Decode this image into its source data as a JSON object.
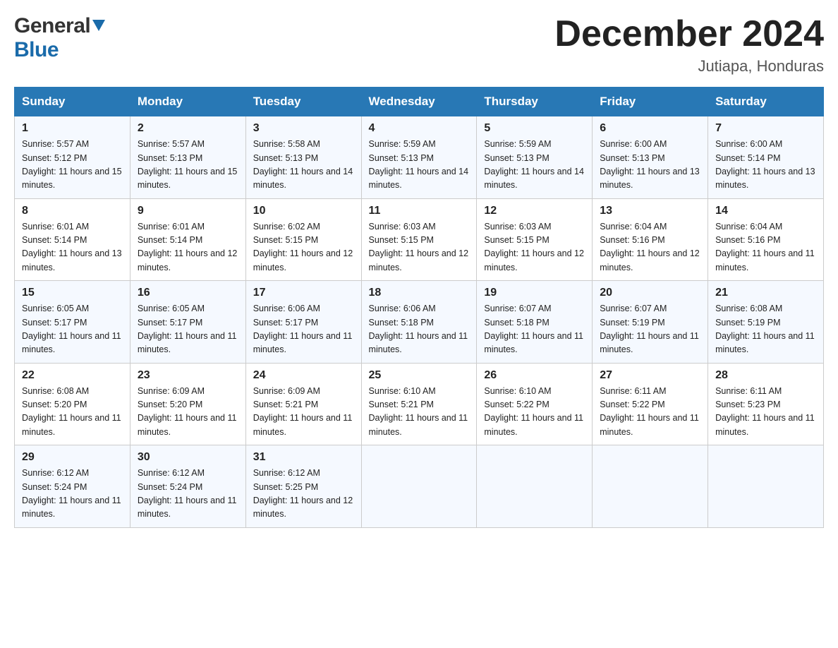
{
  "header": {
    "logo_general": "General",
    "logo_blue": "Blue",
    "month_title": "December 2024",
    "location": "Jutiapa, Honduras"
  },
  "days_of_week": [
    "Sunday",
    "Monday",
    "Tuesday",
    "Wednesday",
    "Thursday",
    "Friday",
    "Saturday"
  ],
  "weeks": [
    [
      {
        "day": "1",
        "sunrise": "5:57 AM",
        "sunset": "5:12 PM",
        "daylight": "11 hours and 15 minutes."
      },
      {
        "day": "2",
        "sunrise": "5:57 AM",
        "sunset": "5:13 PM",
        "daylight": "11 hours and 15 minutes."
      },
      {
        "day": "3",
        "sunrise": "5:58 AM",
        "sunset": "5:13 PM",
        "daylight": "11 hours and 14 minutes."
      },
      {
        "day": "4",
        "sunrise": "5:59 AM",
        "sunset": "5:13 PM",
        "daylight": "11 hours and 14 minutes."
      },
      {
        "day": "5",
        "sunrise": "5:59 AM",
        "sunset": "5:13 PM",
        "daylight": "11 hours and 14 minutes."
      },
      {
        "day": "6",
        "sunrise": "6:00 AM",
        "sunset": "5:13 PM",
        "daylight": "11 hours and 13 minutes."
      },
      {
        "day": "7",
        "sunrise": "6:00 AM",
        "sunset": "5:14 PM",
        "daylight": "11 hours and 13 minutes."
      }
    ],
    [
      {
        "day": "8",
        "sunrise": "6:01 AM",
        "sunset": "5:14 PM",
        "daylight": "11 hours and 13 minutes."
      },
      {
        "day": "9",
        "sunrise": "6:01 AM",
        "sunset": "5:14 PM",
        "daylight": "11 hours and 12 minutes."
      },
      {
        "day": "10",
        "sunrise": "6:02 AM",
        "sunset": "5:15 PM",
        "daylight": "11 hours and 12 minutes."
      },
      {
        "day": "11",
        "sunrise": "6:03 AM",
        "sunset": "5:15 PM",
        "daylight": "11 hours and 12 minutes."
      },
      {
        "day": "12",
        "sunrise": "6:03 AM",
        "sunset": "5:15 PM",
        "daylight": "11 hours and 12 minutes."
      },
      {
        "day": "13",
        "sunrise": "6:04 AM",
        "sunset": "5:16 PM",
        "daylight": "11 hours and 12 minutes."
      },
      {
        "day": "14",
        "sunrise": "6:04 AM",
        "sunset": "5:16 PM",
        "daylight": "11 hours and 11 minutes."
      }
    ],
    [
      {
        "day": "15",
        "sunrise": "6:05 AM",
        "sunset": "5:17 PM",
        "daylight": "11 hours and 11 minutes."
      },
      {
        "day": "16",
        "sunrise": "6:05 AM",
        "sunset": "5:17 PM",
        "daylight": "11 hours and 11 minutes."
      },
      {
        "day": "17",
        "sunrise": "6:06 AM",
        "sunset": "5:17 PM",
        "daylight": "11 hours and 11 minutes."
      },
      {
        "day": "18",
        "sunrise": "6:06 AM",
        "sunset": "5:18 PM",
        "daylight": "11 hours and 11 minutes."
      },
      {
        "day": "19",
        "sunrise": "6:07 AM",
        "sunset": "5:18 PM",
        "daylight": "11 hours and 11 minutes."
      },
      {
        "day": "20",
        "sunrise": "6:07 AM",
        "sunset": "5:19 PM",
        "daylight": "11 hours and 11 minutes."
      },
      {
        "day": "21",
        "sunrise": "6:08 AM",
        "sunset": "5:19 PM",
        "daylight": "11 hours and 11 minutes."
      }
    ],
    [
      {
        "day": "22",
        "sunrise": "6:08 AM",
        "sunset": "5:20 PM",
        "daylight": "11 hours and 11 minutes."
      },
      {
        "day": "23",
        "sunrise": "6:09 AM",
        "sunset": "5:20 PM",
        "daylight": "11 hours and 11 minutes."
      },
      {
        "day": "24",
        "sunrise": "6:09 AM",
        "sunset": "5:21 PM",
        "daylight": "11 hours and 11 minutes."
      },
      {
        "day": "25",
        "sunrise": "6:10 AM",
        "sunset": "5:21 PM",
        "daylight": "11 hours and 11 minutes."
      },
      {
        "day": "26",
        "sunrise": "6:10 AM",
        "sunset": "5:22 PM",
        "daylight": "11 hours and 11 minutes."
      },
      {
        "day": "27",
        "sunrise": "6:11 AM",
        "sunset": "5:22 PM",
        "daylight": "11 hours and 11 minutes."
      },
      {
        "day": "28",
        "sunrise": "6:11 AM",
        "sunset": "5:23 PM",
        "daylight": "11 hours and 11 minutes."
      }
    ],
    [
      {
        "day": "29",
        "sunrise": "6:12 AM",
        "sunset": "5:24 PM",
        "daylight": "11 hours and 11 minutes."
      },
      {
        "day": "30",
        "sunrise": "6:12 AM",
        "sunset": "5:24 PM",
        "daylight": "11 hours and 11 minutes."
      },
      {
        "day": "31",
        "sunrise": "6:12 AM",
        "sunset": "5:25 PM",
        "daylight": "11 hours and 12 minutes."
      },
      null,
      null,
      null,
      null
    ]
  ]
}
